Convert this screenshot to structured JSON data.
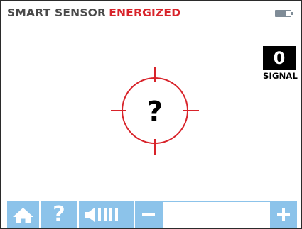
{
  "header": {
    "status_prefix": "SMART SENSOR",
    "status_state": "ENERGIZED"
  },
  "battery": {
    "icon": "battery-icon",
    "level": 0.75,
    "color": "#7f8c97"
  },
  "signal": {
    "value": "0",
    "label": "SIGNAL"
  },
  "target": {
    "symbol": "?",
    "icon": "crosshair-reticle-icon",
    "color": "#d8232a"
  },
  "toolbar": {
    "home_icon": "home-icon",
    "help_label": "?",
    "volume_icon": "speaker-volume-icon",
    "volume_level_bars": 4,
    "minus_icon": "minus-icon",
    "plus_icon": "plus-icon",
    "button_color": "#8cc3ea"
  },
  "colors": {
    "accent_red": "#d8232a",
    "text_dark": "#4a4a4a"
  }
}
